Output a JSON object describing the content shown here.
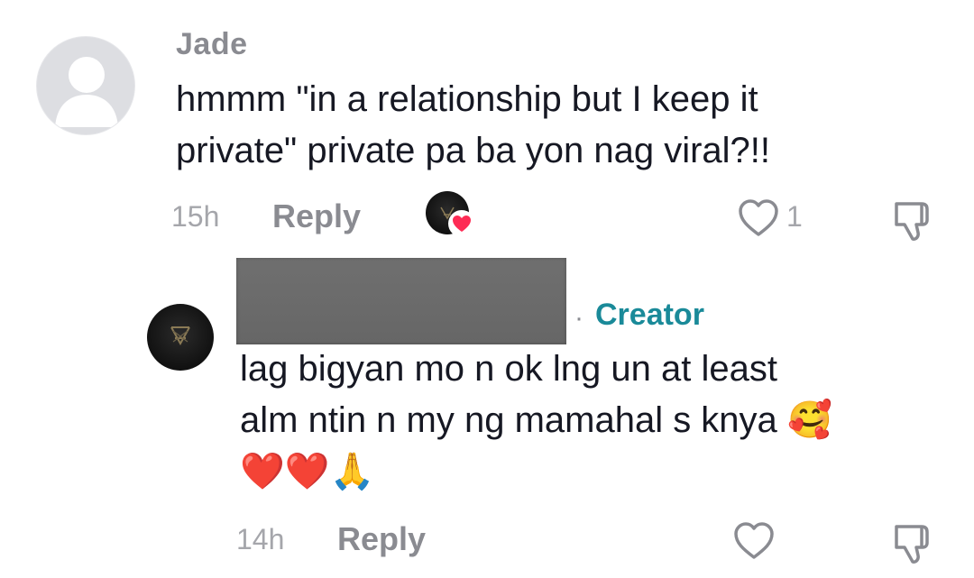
{
  "comment": {
    "username": "Jade",
    "text_line1": "hmmm \"in a relationship but I keep it",
    "text_line2": "private\" private pa ba yon nag viral?!!",
    "time": "15h",
    "reply_label": "Reply",
    "like_count": "1",
    "avatar_icon": "default-user-avatar",
    "liked_by_creator_icon": "creator-heart-badge"
  },
  "reply": {
    "creator_label": "Creator",
    "separator": "·",
    "text_line1": "lag bigyan mo n ok lng un at least",
    "text_line2": "alm ntin n my ng mamahal s knya",
    "emoji_smiling_hearts": "🥰",
    "emoji_hearts": "❤️❤️",
    "emoji_pray": "🙏",
    "time": "14h",
    "reply_label": "Reply",
    "avatar_icon": "creator-avatar",
    "username_redacted": true
  },
  "colors": {
    "creator_teal": "#1a8a99",
    "text_dark": "#161823",
    "meta_gray": "#a5a6ab",
    "heart_red": "#fe2c55"
  }
}
